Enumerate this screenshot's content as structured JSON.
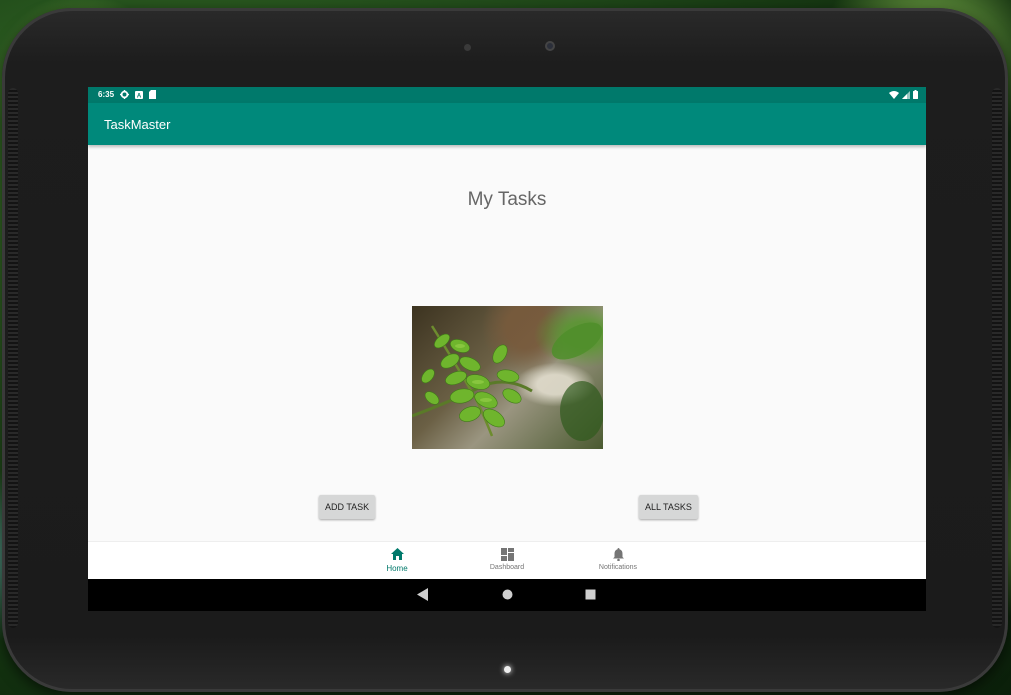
{
  "status_bar": {
    "time": "6:35"
  },
  "app_bar": {
    "title": "TaskMaster"
  },
  "main": {
    "heading": "My Tasks",
    "add_task_label": "ADD TASK",
    "all_tasks_label": "ALL TASKS"
  },
  "bottom_nav": {
    "items": [
      {
        "label": "Home",
        "icon": "home-icon",
        "active": true
      },
      {
        "label": "Dashboard",
        "icon": "dashboard-icon",
        "active": false
      },
      {
        "label": "Notifications",
        "icon": "bell-icon",
        "active": false
      }
    ]
  },
  "system_nav": {
    "icons": [
      "back-icon",
      "home-circle-icon",
      "recents-icon"
    ]
  },
  "colors": {
    "status_bar": "#00796b",
    "app_bar": "#00897b",
    "active_nav": "#00796b",
    "button_bg": "#d6d7d7"
  }
}
